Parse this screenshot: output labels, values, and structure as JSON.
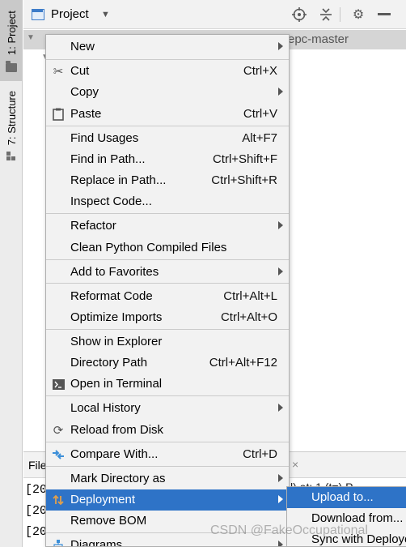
{
  "toolstrip": {
    "project_tab": "1: Project",
    "structure_tab": "7: Structure"
  },
  "header": {
    "title": "Project"
  },
  "tree": {
    "root_visible_text": "epc-master"
  },
  "bottom_panel": {
    "tab_label": "File",
    "close_glyph": "×",
    "trail_text": "l) at: 1 (t=) P",
    "log_lines": [
      "[20",
      "[20",
      "[20"
    ]
  },
  "context_menu": {
    "items": [
      {
        "label": "New",
        "mnemonic": "",
        "shortcut": "",
        "icon": "",
        "submenu": true
      },
      {
        "label": "Cut",
        "shortcut": "Ctrl+X",
        "icon": "scissors-icon"
      },
      {
        "label": "Copy",
        "shortcut": "",
        "icon": "",
        "submenu": true
      },
      {
        "label": "Paste",
        "shortcut": "Ctrl+V",
        "icon": "clipboard-icon"
      },
      {
        "label": "Find Usages",
        "shortcut": "Alt+F7"
      },
      {
        "label": "Find in Path...",
        "shortcut": "Ctrl+Shift+F"
      },
      {
        "label": "Replace in Path...",
        "shortcut": "Ctrl+Shift+R"
      },
      {
        "label": "Inspect Code..."
      },
      {
        "label": "Refactor",
        "submenu": true
      },
      {
        "label": "Clean Python Compiled Files"
      },
      {
        "label": "Add to Favorites",
        "submenu": true
      },
      {
        "label": "Reformat Code",
        "shortcut": "Ctrl+Alt+L"
      },
      {
        "label": "Optimize Imports",
        "shortcut": "Ctrl+Alt+O"
      },
      {
        "label": "Show in Explorer"
      },
      {
        "label": "Directory Path",
        "shortcut": "Ctrl+Alt+F12"
      },
      {
        "label": "Open in Terminal",
        "icon": "terminal-icon"
      },
      {
        "label": "Local History",
        "submenu": true
      },
      {
        "label": "Reload from Disk",
        "icon": "reload-icon"
      },
      {
        "label": "Compare With...",
        "shortcut": "Ctrl+D",
        "icon": "compare-icon"
      },
      {
        "label": "Mark Directory as",
        "submenu": true
      },
      {
        "label": "Deployment",
        "submenu": true,
        "selected": true,
        "icon": "deployment-icon"
      },
      {
        "label": "Remove BOM"
      },
      {
        "label": "Diagrams",
        "submenu": true,
        "icon": "diagram-icon"
      }
    ]
  },
  "submenu": {
    "items": [
      {
        "label": "Upload to...",
        "selected": true
      },
      {
        "label": "Download from..."
      },
      {
        "label": "Sync with Deployed"
      }
    ]
  },
  "watermark": "CSDN @FakeOccupational",
  "colors": {
    "selection": "#2e73c7",
    "menu_bg": "#f2f2f2"
  }
}
